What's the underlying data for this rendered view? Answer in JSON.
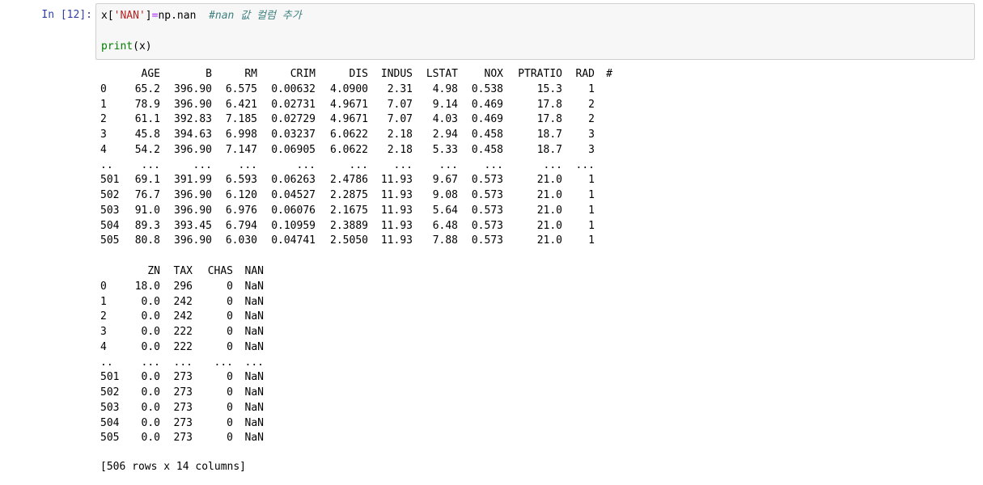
{
  "cell": {
    "prompt": "In [12]:",
    "code": {
      "line1": {
        "var": "x",
        "open": "[",
        "key": "'NAN'",
        "close": "]",
        "assign": "=",
        "rhs": "np.nan",
        "comment": "#nan 값 컬럼 추가"
      },
      "line2": {
        "func": "print",
        "args": "(x)"
      }
    }
  },
  "output": {
    "block1": {
      "columns": [
        "AGE",
        "B",
        "RM",
        "CRIM",
        "DIS",
        "INDUS",
        "LSTAT",
        "NOX",
        "PTRATIO",
        "RAD",
        "#"
      ],
      "rows": [
        {
          "index": "0",
          "cells": [
            "65.2",
            "396.90",
            "6.575",
            "0.00632",
            "4.0900",
            "2.31",
            "4.98",
            "0.538",
            "15.3",
            "1",
            ""
          ]
        },
        {
          "index": "1",
          "cells": [
            "78.9",
            "396.90",
            "6.421",
            "0.02731",
            "4.9671",
            "7.07",
            "9.14",
            "0.469",
            "17.8",
            "2",
            ""
          ]
        },
        {
          "index": "2",
          "cells": [
            "61.1",
            "392.83",
            "7.185",
            "0.02729",
            "4.9671",
            "7.07",
            "4.03",
            "0.469",
            "17.8",
            "2",
            ""
          ]
        },
        {
          "index": "3",
          "cells": [
            "45.8",
            "394.63",
            "6.998",
            "0.03237",
            "6.0622",
            "2.18",
            "2.94",
            "0.458",
            "18.7",
            "3",
            ""
          ]
        },
        {
          "index": "4",
          "cells": [
            "54.2",
            "396.90",
            "7.147",
            "0.06905",
            "6.0622",
            "2.18",
            "5.33",
            "0.458",
            "18.7",
            "3",
            ""
          ]
        },
        {
          "index": "..",
          "cells": [
            "...",
            "...",
            "...",
            "...",
            "...",
            "...",
            "...",
            "...",
            "...",
            "...",
            ""
          ]
        },
        {
          "index": "501",
          "cells": [
            "69.1",
            "391.99",
            "6.593",
            "0.06263",
            "2.4786",
            "11.93",
            "9.67",
            "0.573",
            "21.0",
            "1",
            ""
          ]
        },
        {
          "index": "502",
          "cells": [
            "76.7",
            "396.90",
            "6.120",
            "0.04527",
            "2.2875",
            "11.93",
            "9.08",
            "0.573",
            "21.0",
            "1",
            ""
          ]
        },
        {
          "index": "503",
          "cells": [
            "91.0",
            "396.90",
            "6.976",
            "0.06076",
            "2.1675",
            "11.93",
            "5.64",
            "0.573",
            "21.0",
            "1",
            ""
          ]
        },
        {
          "index": "504",
          "cells": [
            "89.3",
            "393.45",
            "6.794",
            "0.10959",
            "2.3889",
            "11.93",
            "6.48",
            "0.573",
            "21.0",
            "1",
            ""
          ]
        },
        {
          "index": "505",
          "cells": [
            "80.8",
            "396.90",
            "6.030",
            "0.04741",
            "2.5050",
            "11.93",
            "7.88",
            "0.573",
            "21.0",
            "1",
            ""
          ]
        }
      ]
    },
    "block2": {
      "columns": [
        "ZN",
        "TAX",
        "CHAS",
        "NAN"
      ],
      "rows": [
        {
          "index": "0",
          "cells": [
            "18.0",
            "296",
            "0",
            "NaN"
          ]
        },
        {
          "index": "1",
          "cells": [
            "0.0",
            "242",
            "0",
            "NaN"
          ]
        },
        {
          "index": "2",
          "cells": [
            "0.0",
            "242",
            "0",
            "NaN"
          ]
        },
        {
          "index": "3",
          "cells": [
            "0.0",
            "222",
            "0",
            "NaN"
          ]
        },
        {
          "index": "4",
          "cells": [
            "0.0",
            "222",
            "0",
            "NaN"
          ]
        },
        {
          "index": "..",
          "cells": [
            "...",
            "...",
            "...",
            "..."
          ]
        },
        {
          "index": "501",
          "cells": [
            "0.0",
            "273",
            "0",
            "NaN"
          ]
        },
        {
          "index": "502",
          "cells": [
            "0.0",
            "273",
            "0",
            "NaN"
          ]
        },
        {
          "index": "503",
          "cells": [
            "0.0",
            "273",
            "0",
            "NaN"
          ]
        },
        {
          "index": "504",
          "cells": [
            "0.0",
            "273",
            "0",
            "NaN"
          ]
        },
        {
          "index": "505",
          "cells": [
            "0.0",
            "273",
            "0",
            "NaN"
          ]
        }
      ]
    },
    "footer": "[506 rows x 14 columns]"
  }
}
